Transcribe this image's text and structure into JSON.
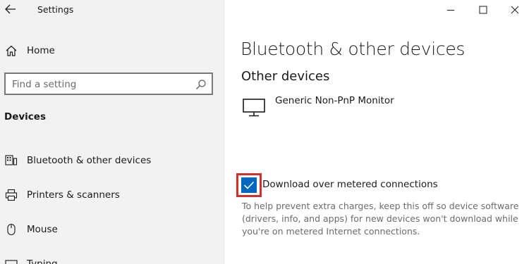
{
  "window": {
    "title": "Settings"
  },
  "sidebar": {
    "home_label": "Home",
    "search": {
      "placeholder": "Find a setting"
    },
    "section_header": "Devices",
    "items": [
      {
        "label": "Bluetooth & other devices",
        "icon": "bluetooth-devices-icon"
      },
      {
        "label": "Printers & scanners",
        "icon": "printer-icon"
      },
      {
        "label": "Mouse",
        "icon": "mouse-icon"
      },
      {
        "label": "Typing",
        "icon": "keyboard-icon"
      }
    ]
  },
  "main": {
    "title": "Bluetooth & other devices",
    "section_title": "Other devices",
    "device": {
      "name": "Generic Non-PnP Monitor",
      "icon": "monitor-icon"
    },
    "metered_option": {
      "label": "Download over metered connections",
      "checked": true,
      "help_text": "To help prevent extra charges, keep this off so device software (drivers, info, and apps) for new devices won't download while you're on metered Internet connections."
    }
  },
  "colors": {
    "accent": "#0067c0",
    "highlight_border": "#d32f2f",
    "sidebar_bg": "#f2f2f2"
  }
}
